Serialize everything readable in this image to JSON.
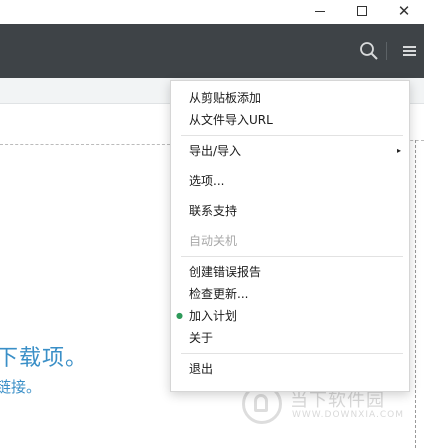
{
  "window": {
    "minimize_glyph": "—",
    "maximize_glyph": "☐",
    "close_glyph": "✕"
  },
  "toolbar": {
    "search_icon": "search-icon",
    "menu_icon": "hamburger-menu-icon",
    "background_color": "#3e4347"
  },
  "content": {
    "title": "下载项。",
    "subtitle": "链接。"
  },
  "watermark": {
    "cn": "当下软件园",
    "en": "WWW.DOWNXIA.COM"
  },
  "menu": {
    "items": [
      {
        "label": "从剪贴板添加",
        "enabled": true
      },
      {
        "label": "从文件导入URL",
        "enabled": true
      },
      {
        "label": "导出/导入",
        "enabled": true,
        "submenu": true,
        "arrow": "▸"
      },
      {
        "label": "选项...",
        "enabled": true
      },
      {
        "label": "联系支持",
        "enabled": true
      },
      {
        "label": "自动关机",
        "enabled": false
      },
      {
        "label": "创建错误报告",
        "enabled": true
      },
      {
        "label": "检查更新...",
        "enabled": true
      },
      {
        "label": "加入计划",
        "enabled": true,
        "marked": true,
        "mark": "●"
      },
      {
        "label": "关于",
        "enabled": true
      },
      {
        "label": "退出",
        "enabled": true
      }
    ]
  }
}
